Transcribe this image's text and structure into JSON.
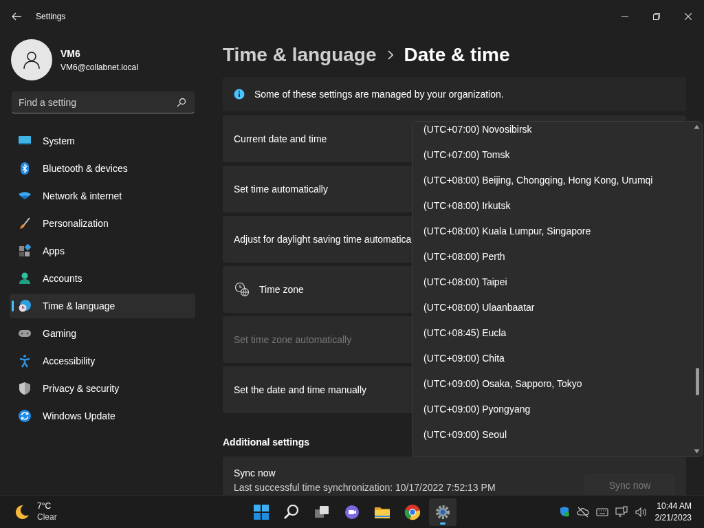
{
  "window": {
    "title": "Settings"
  },
  "user": {
    "name": "VM6",
    "email": "VM6@collabnet.local"
  },
  "search": {
    "placeholder": "Find a setting"
  },
  "sidebar": {
    "items": [
      {
        "label": "System",
        "selected": false
      },
      {
        "label": "Bluetooth & devices",
        "selected": false
      },
      {
        "label": "Network & internet",
        "selected": false
      },
      {
        "label": "Personalization",
        "selected": false
      },
      {
        "label": "Apps",
        "selected": false
      },
      {
        "label": "Accounts",
        "selected": false
      },
      {
        "label": "Time & language",
        "selected": true
      },
      {
        "label": "Gaming",
        "selected": false
      },
      {
        "label": "Accessibility",
        "selected": false
      },
      {
        "label": "Privacy & security",
        "selected": false
      },
      {
        "label": "Windows Update",
        "selected": false
      }
    ]
  },
  "breadcrumb": {
    "parent": "Time & language",
    "current": "Date & time"
  },
  "info_bar": {
    "text": "Some of these settings are managed by your organization."
  },
  "settings": [
    {
      "label": "Current date and time",
      "disabled": false,
      "kind": "plain"
    },
    {
      "label": "Set time automatically",
      "disabled": false,
      "kind": "plain"
    },
    {
      "label": "Adjust for daylight saving time automatica",
      "disabled": false,
      "kind": "plain"
    },
    {
      "label": "Time zone",
      "disabled": false,
      "kind": "timezone"
    },
    {
      "label": "Set time zone automatically",
      "disabled": true,
      "kind": "plain"
    },
    {
      "label": "Set the date and time manually",
      "disabled": false,
      "kind": "plain"
    }
  ],
  "additional_settings": {
    "heading": "Additional settings",
    "sync": {
      "title": "Sync now",
      "detail": "Last successful time synchronization: 10/17/2022 7:52:13 PM",
      "button": {
        "label": "Sync now",
        "disabled": true
      }
    }
  },
  "timezone_dropdown": {
    "options": [
      "(UTC+07:00) Novosibirsk",
      "(UTC+07:00) Tomsk",
      "(UTC+08:00) Beijing, Chongqing, Hong Kong, Urumqi",
      "(UTC+08:00) Irkutsk",
      "(UTC+08:00) Kuala Lumpur, Singapore",
      "(UTC+08:00) Perth",
      "(UTC+08:00) Taipei",
      "(UTC+08:00) Ulaanbaatar",
      "(UTC+08:45) Eucla",
      "(UTC+09:00) Chita",
      "(UTC+09:00) Osaka, Sapporo, Tokyo",
      "(UTC+09:00) Pyongyang",
      "(UTC+09:00) Seoul"
    ]
  },
  "taskbar": {
    "weather": {
      "temperature": "7°C",
      "condition": "Clear"
    },
    "apps": [
      {
        "kind": "start",
        "active": false
      },
      {
        "kind": "search",
        "active": false
      },
      {
        "kind": "taskview",
        "active": false
      },
      {
        "kind": "chat",
        "active": false
      },
      {
        "kind": "explorer",
        "active": false
      },
      {
        "kind": "browser",
        "active": false
      },
      {
        "kind": "settings",
        "active": true
      }
    ],
    "clock": {
      "time": "10:44 AM",
      "date": "2/21/2023"
    }
  }
}
